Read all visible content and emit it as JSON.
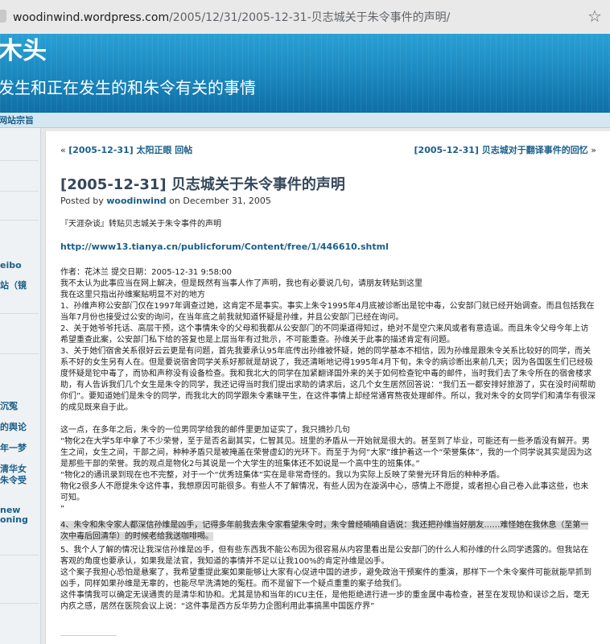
{
  "browser": {
    "url_host": "woodinwind.wordpress.com",
    "url_path": "/2005/12/31/2005-12-31-贝志城关于朱令事件的声明/"
  },
  "site": {
    "title": "木头",
    "tagline": "发生和正在发生的和朱令有关的事情",
    "nav_item": "网站宗旨"
  },
  "sidebar": {
    "links": [
      "eibo",
      "站（镜",
      "沉冤",
      "的舆论",
      "年一梦",
      "清华女",
      "朱令受",
      "new",
      "oning"
    ]
  },
  "post_nav": {
    "prev_label": "[2005-12-31] 太阳正眼 回帖",
    "next_label": "[2005-12-31] 贝志城对于翻译事件的回忆"
  },
  "post": {
    "title": "[2005-12-31] 贝志城关于朱令事件的声明",
    "posted_by_prefix": "Posted by",
    "author": "woodinwind",
    "date_prefix": "on",
    "date": "December 31, 2005",
    "intro": "『天涯杂谈』转贴贝志城关于朱令事件的声明",
    "link": "http://www13.tianya.cn/publicforum/Content/free/1/446610.shtml",
    "paragraphs": [
      "作者：花沐兰 提交日期：2005-12-31 9:58:00",
      "我不太认为此事应当在网上解决，但是既然有当事人作了声明，我也有必要说几句，请朋友转贴到这里",
      "我在这里只指出孙维案贴明显不对的地方",
      "1、孙维声称公安部门仅在1997年调查过她，这肯定不是事实。事实上朱令1995年4月底被诊断出是铊中毒，公安部门就已经开始调查。而且包括我在当年7月份也接受过公安的询问，在当年底之前我就知道怀疑是孙维，并且公安部门已经在询问。",
      "2、关于她爷爷托话、高层干预，这个事情朱令的父母和我都从公安部门的不同渠道得知过，绝对不是空穴来风或者有意造谣。而且朱令父母今年上访希望重查此案，公安部门私下给的答复也是上层当年有过批示，不可能重查。孙维关于此事的描述肯定有问题。",
      "3、关于她们宿舍关系很好云云更是有问题，首先我要承认95年底传出孙维被怀疑，她的同学基本不相信，因为孙维是跟朱令关系比较好的同学，而关系不好的女生另有人在。但是要说宿舍同学关系好那就是胡说了，我还清晰地记得1995年4月下旬，朱令的病诊断出来前几天；因为各国医生们已经极度怀疑是铊中毒了，而协和声称没有设备检查。我和我北大的同学在加紧翻译国外来的关于如何检查铊中毒的邮件，当时我们去了朱令所在的宿舍楼求助，有人告诉我们几个女生是朱令的同学，我还记得当时我们提出求助的请求后，这几个女生居然回答说：“我们五一都安排好旅游了，实在没时间帮助你们”。要知道她们是朱令的同学，而我北大的同学跟朱令素昧平生，在这件事情上却经常通宵熬夜处理邮件。所以，我对朱令的女同学们和清华有很深的成见既来自于此。",
      "这一点，在多年之后，朱令的一位男同学给我的邮件里更加证实了，我只摘抄几句",
      "“物化2在大学5年中拿了不少荣誉，至于是否名副其实，仁智其见。班里的矛盾从一开始就是很大的。甚至到了毕业，可能还有一些矛盾没有解开。男生之间，女生之间，干部之间，种种矛盾只是被掩盖在荣誉虚幻的光环下。而至于为何“大家”维护着这一个“荣誉集体”，我的一个同学说其实是因为这是那些干部的荣誉。我的观点是物化2与其说是一个大学生的班集体还不如说是一个高中生的班集体。”",
      "“物化2的通讯录到现在也不完整，对于一个“优秀班集体”实在是非常奇怪的。我以为实际上反映了荣誉光环背后的种种矛盾。",
      "物化2很多人不愿提朱令这件事，我想原因可能很多。有些人不了解情况，有些人因为在漩涡中心，感情上不愿提，或者担心自己卷入此事这些，也未可知。",
      "”"
    ],
    "highlight": "4、朱令和朱令家人都深信孙维是凶手，记得多年前我去朱令家看望朱令时，朱令曾经喃喃自语说：我还把孙维当好朋友……难怪她在我休息（至第一次中毒后回清华）的时候老给我送咖啡喝。",
    "paragraphs_after": [
      "5、我个人了解的情况让我深信孙维是凶手，但有些东西我不能公布因为很容易从内容里看出是公安部门的什么人和孙维的什么同学透露的。但我站在客观的角度也要承认，如果我是法官，我知道的事情并不足以让我100%的肯定孙维是凶手。",
      "这个案子我担心恐怕是悬案了，我希望重提此案如果能够让大家有心促进中国的进步，避免政治干预案件的重演，那样下一个朱令案件可能就能早抓到凶手，同样如果孙维是无辜的，也能尽早洗清她的冤枉。而不是留下一个疑点重重的案子给我们。",
      "这件事情我可以确定无误通责的是清华和协和。尤其是协和当年的ICU主任，是他拒绝进行进一步的重金属中毒检查，甚至在发现协和误诊之后，毫无内疚之感，居然在医院会议上说：“这件事是西方反华势力企图利用此事搞黑中国医疗界”"
    ]
  }
}
